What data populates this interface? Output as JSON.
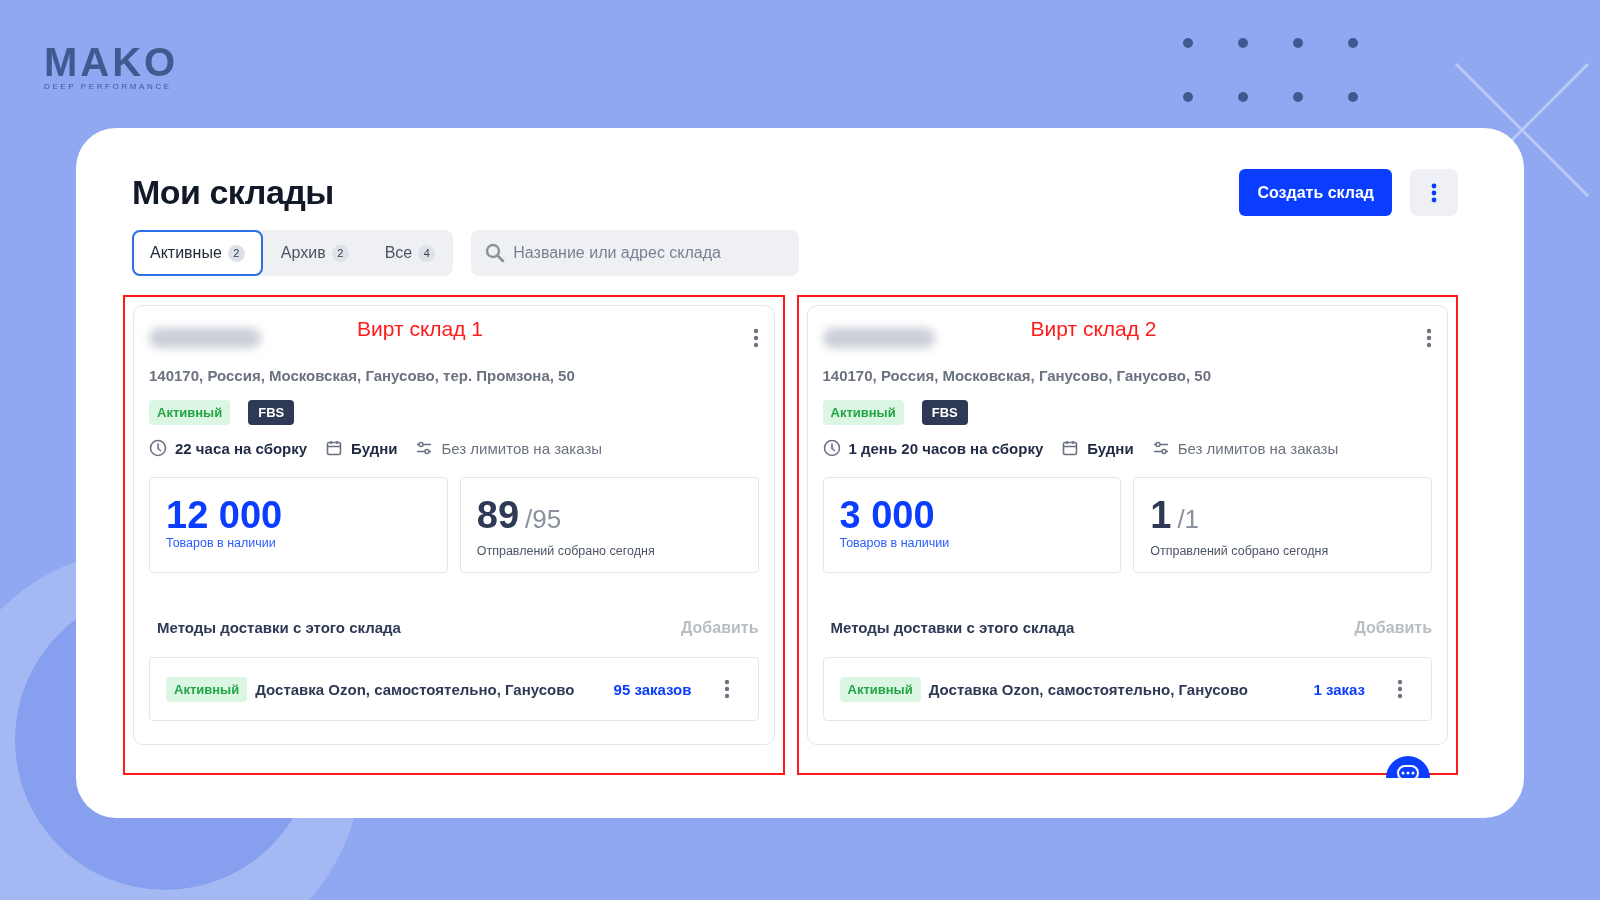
{
  "brand": {
    "logo": "MAKO",
    "tagline": "DEEP PERFORMANCE"
  },
  "page": {
    "title": "Мои склады"
  },
  "actions": {
    "create_button": "Создать склад"
  },
  "tabs": [
    {
      "label": "Активные",
      "count": "2",
      "selected": true
    },
    {
      "label": "Архив",
      "count": "2",
      "selected": false
    },
    {
      "label": "Все",
      "count": "4",
      "selected": false
    }
  ],
  "search": {
    "placeholder": "Название или адрес склада"
  },
  "warehouses": [
    {
      "annotation": "Вирт склад 1",
      "address": "140170, Россия, Московская, Ганусово, тер. Промзона, 50",
      "status": "Активный",
      "scheme": "FBS",
      "assembly_time": "22 часа на сборку",
      "schedule": "Будни",
      "limits": "Без лимитов на заказы",
      "stock": "12 000",
      "stock_label": "Товаров в наличии",
      "shipped": "89",
      "shipped_total": "/95",
      "shipped_label": "Отправлений собрано сегодня",
      "delivery_heading": "Методы доставки с этого склада",
      "add_link": "Добавить",
      "delivery_methods": [
        {
          "status": "Активный",
          "name": "Доставка Ozon, самостоятельно, Ганусово",
          "orders": "95 заказов"
        }
      ]
    },
    {
      "annotation": "Вирт склад 2",
      "address": "140170, Россия, Московская, Ганусово, Ганусово, 50",
      "status": "Активный",
      "scheme": "FBS",
      "assembly_time": "1 день 20 часов на сборку",
      "schedule": "Будни",
      "limits": "Без лимитов на заказы",
      "stock": "3 000",
      "stock_label": "Товаров в наличии",
      "shipped": "1",
      "shipped_total": "/1",
      "shipped_label": "Отправлений собрано сегодня",
      "delivery_heading": "Методы доставки с этого склада",
      "add_link": "Добавить",
      "delivery_methods": [
        {
          "status": "Активный",
          "name": "Доставка Ozon, самостоятельно, Ганусово",
          "orders": "1 заказ"
        }
      ]
    }
  ]
}
